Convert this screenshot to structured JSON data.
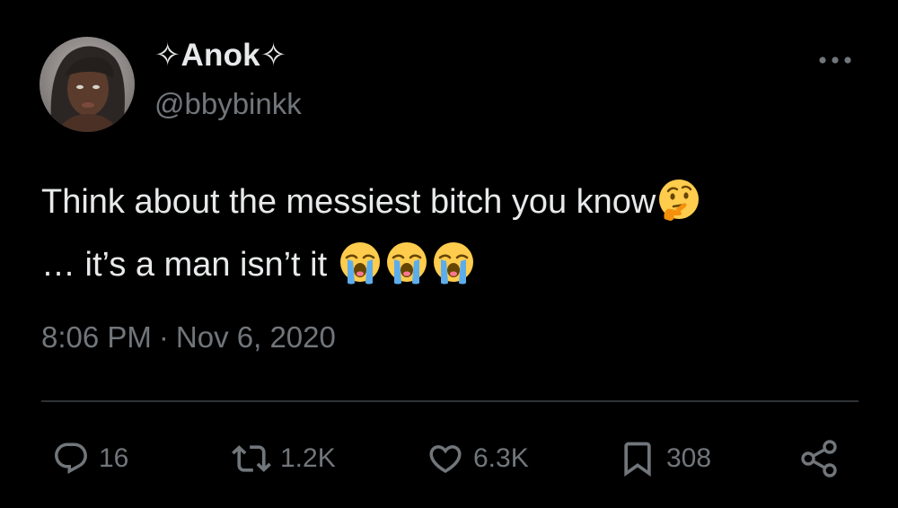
{
  "author": {
    "display_name": "✧Anok✧",
    "handle": "@bbybinkk"
  },
  "tweet": {
    "line1": "Think about the messiest bitch you know",
    "line1_emoji": "thinking-face-emoji",
    "line2": "… it’s a man isn’t it",
    "line2_emojis": [
      "loudly-crying-face-emoji",
      "loudly-crying-face-emoji",
      "loudly-crying-face-emoji"
    ]
  },
  "meta": {
    "time": "8:06 PM",
    "separator": "·",
    "date": "Nov 6, 2020"
  },
  "actions": {
    "replies": "16",
    "retweets": "1.2K",
    "likes": "6.3K",
    "bookmarks": "308"
  },
  "colors": {
    "background": "#000000",
    "primary_text": "#e7e9ea",
    "secondary_text": "#71767b",
    "divider": "#2f3336"
  },
  "icons": {
    "more": "more-horizontal-icon",
    "reply": "reply-icon",
    "retweet": "retweet-icon",
    "like": "heart-icon",
    "bookmark": "bookmark-icon",
    "share": "share-icon"
  }
}
